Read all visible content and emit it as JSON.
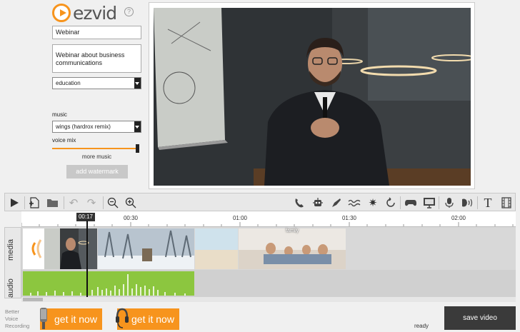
{
  "app": {
    "logo_text": "ezvid",
    "help_glyph": "?"
  },
  "project": {
    "title": "Webinar",
    "description": "Webinar about business communications",
    "category": "education"
  },
  "music": {
    "label": "music",
    "track": "wings (hardrox remix)",
    "voice_mix_label": "voice mix",
    "voice_mix_level": 0.97,
    "more_music": "more music",
    "add_watermark": "add watermark"
  },
  "toolbar": {
    "icons": [
      "play-icon",
      "new-file-icon",
      "open-folder-icon",
      "undo-icon",
      "redo-icon",
      "zoom-out-icon",
      "zoom-in-icon",
      "phone-icon",
      "robot-icon",
      "pen-icon",
      "wave-icon",
      "burst-icon",
      "refresh-icon",
      "gamepad-icon",
      "monitor-icon",
      "microphone-icon",
      "voice-icon",
      "text-icon",
      "film-icon"
    ]
  },
  "timeline": {
    "playhead_time": "00:17",
    "ticks": [
      "00:30",
      "01:00",
      "01:30",
      "02:00"
    ],
    "tracks": [
      "media",
      "audio"
    ],
    "clip_label": "family"
  },
  "bottom": {
    "better_voice": [
      "Better",
      "Voice",
      "Recording"
    ],
    "get_it_now_1": "get it now",
    "get_it_now_2": "get it now",
    "status": "ready",
    "save_video": "save video"
  },
  "colors": {
    "brand_orange": "#f7941d",
    "audio_green": "#8cc63f",
    "save_dark": "#3a3a3a"
  }
}
